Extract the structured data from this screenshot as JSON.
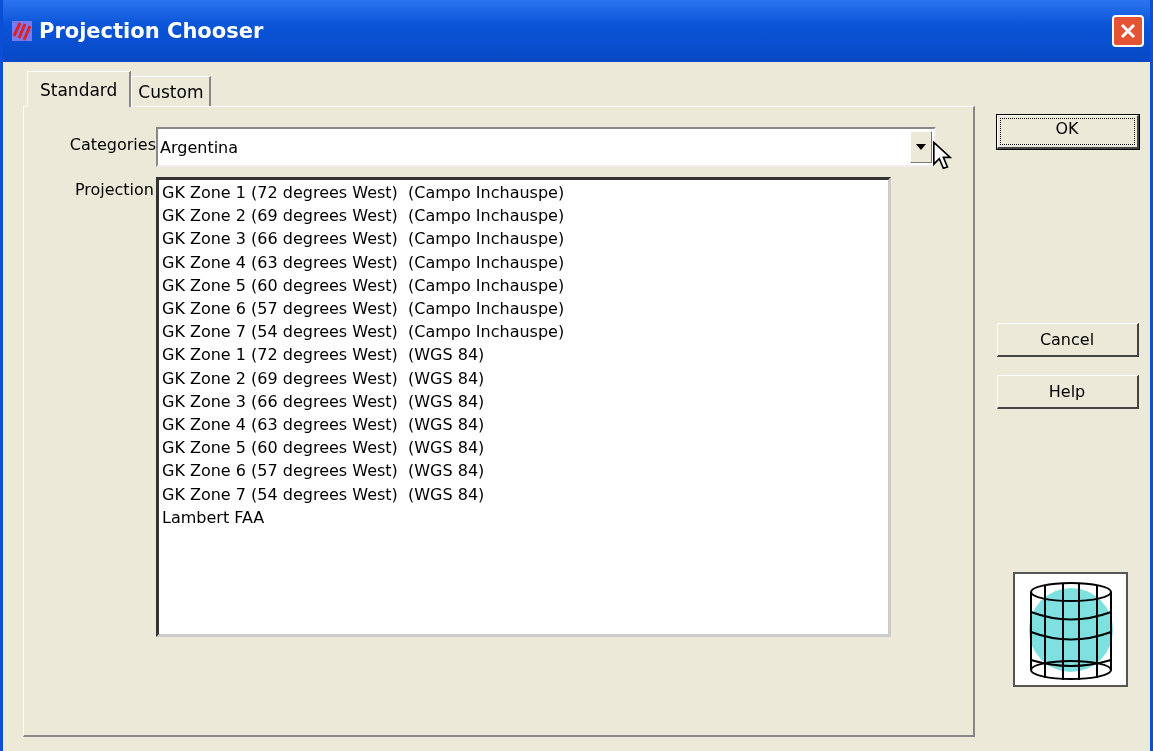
{
  "window": {
    "title": "Projection Chooser"
  },
  "tabs": [
    {
      "label": "Standard",
      "selected": true
    },
    {
      "label": "Custom",
      "selected": false
    }
  ],
  "categories": {
    "label": "Categories",
    "value": "Argentina"
  },
  "projections": {
    "label": "Projection",
    "items": [
      {
        "label": "GK Zone 1 (72 degrees West)  (Campo Inchauspe)",
        "selected": false
      },
      {
        "label": "GK Zone 2 (69 degrees West)  (Campo Inchauspe)",
        "selected": false
      },
      {
        "label": "GK Zone 3 (66 degrees West)  (Campo Inchauspe)",
        "selected": false
      },
      {
        "label": "GK Zone 4 (63 degrees West)  (Campo Inchauspe)",
        "selected": false
      },
      {
        "label": "GK Zone 5 (60 degrees West)  (Campo Inchauspe)",
        "selected": false
      },
      {
        "label": "GK Zone 6 (57 degrees West)  (Campo Inchauspe)",
        "selected": false
      },
      {
        "label": "GK Zone 7 (54 degrees West)  (Campo Inchauspe)",
        "selected": false
      },
      {
        "label": "GK Zone 1 (72 degrees West)  (WGS 84)",
        "selected": false
      },
      {
        "label": "GK Zone 2 (69 degrees West)  (WGS 84)",
        "selected": false
      },
      {
        "label": "GK Zone 3 (66 degrees West)  (WGS 84)",
        "selected": false
      },
      {
        "label": "GK Zone 4 (63 degrees West)  (WGS 84)",
        "selected": false
      },
      {
        "label": "GK Zone 5 (60 degrees West)  (WGS 84)",
        "selected": false
      },
      {
        "label": "GK Zone 6 (57 degrees West)  (WGS 84)",
        "selected": false
      },
      {
        "label": "GK Zone 7 (54 degrees West)  (WGS 84)",
        "selected": false
      },
      {
        "label": "Lambert FAA",
        "selected": false
      }
    ]
  },
  "buttons": [
    {
      "label": "OK",
      "kind": "default"
    },
    {
      "label": "Cancel",
      "kind": "normal"
    },
    {
      "label": "Help",
      "kind": "normal"
    }
  ]
}
